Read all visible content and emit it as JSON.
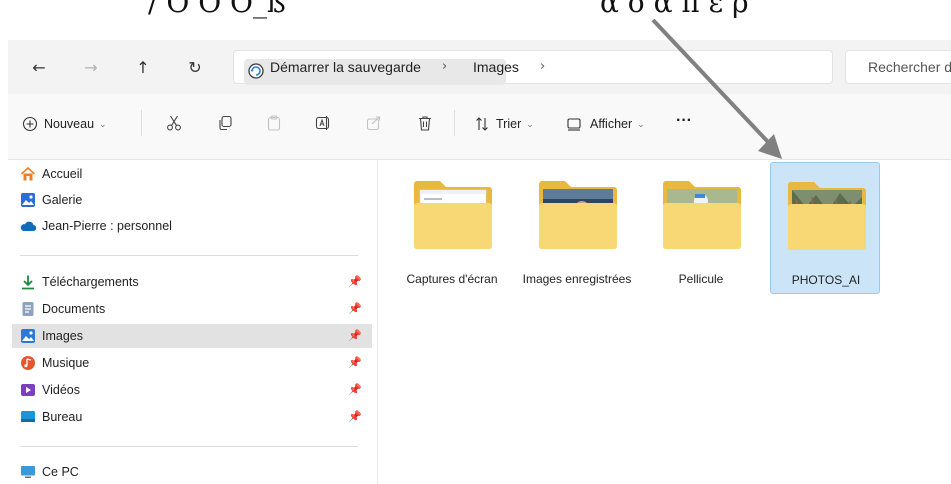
{
  "caption": {
    "left_text": "/ Ó Ó Ó_ß",
    "right_text": "α δ α π ε ρ"
  },
  "address_bar": {
    "back_icon": "arrow-left-icon",
    "forward_icon": "arrow-right-icon",
    "up_icon": "arrow-up-icon",
    "refresh_icon": "refresh-icon",
    "breadcrumbs": [
      "Démarrer la sauvegarde",
      "Images"
    ],
    "search_placeholder": "Rechercher dans Images"
  },
  "toolbar": {
    "new_label": "Nouveau",
    "sort_label": "Trier",
    "view_label": "Afficher",
    "more_label": "···"
  },
  "sidebar": {
    "top_items": [
      {
        "label": "Accueil",
        "icon": "home-icon",
        "color": "#e8812a"
      },
      {
        "label": "Galerie",
        "icon": "gallery-icon",
        "color": "#2a6fd1"
      },
      {
        "label": "Jean-Pierre : personnel",
        "icon": "onedrive-icon",
        "color": "#0f6cbd"
      }
    ],
    "pinned_items": [
      {
        "label": "Téléchargements",
        "icon": "download-icon",
        "color": "#1c8a3c"
      },
      {
        "label": "Documents",
        "icon": "document-icon",
        "color": "#6b7e99"
      },
      {
        "label": "Images",
        "icon": "pictures-icon",
        "color": "#2a7ad6",
        "selected": true
      },
      {
        "label": "Musique",
        "icon": "music-icon",
        "color": "#e4572e"
      },
      {
        "label": "Vidéos",
        "icon": "videos-icon",
        "color": "#7b3fc4"
      },
      {
        "label": "Bureau",
        "icon": "desktop-icon",
        "color": "#1b95d8"
      }
    ],
    "bottom_items": [
      {
        "label": "Ce PC",
        "icon": "computer-icon",
        "color": "#3a9ad9"
      }
    ]
  },
  "folders": [
    {
      "name": "Captures d'écran",
      "icon": "folder-screenshots-icon"
    },
    {
      "name": "Images enregistrées",
      "icon": "folder-saved-pictures-icon"
    },
    {
      "name": "Pellicule",
      "icon": "folder-camera-roll-icon"
    },
    {
      "name": "PHOTOS_AI",
      "icon": "folder-photos-ai-icon",
      "selected": true
    }
  ],
  "colors": {
    "folder_yellow": "#f8d775",
    "folder_dark": "#e9b93f",
    "selection": "#cce4f7",
    "arrow": "#808080"
  }
}
